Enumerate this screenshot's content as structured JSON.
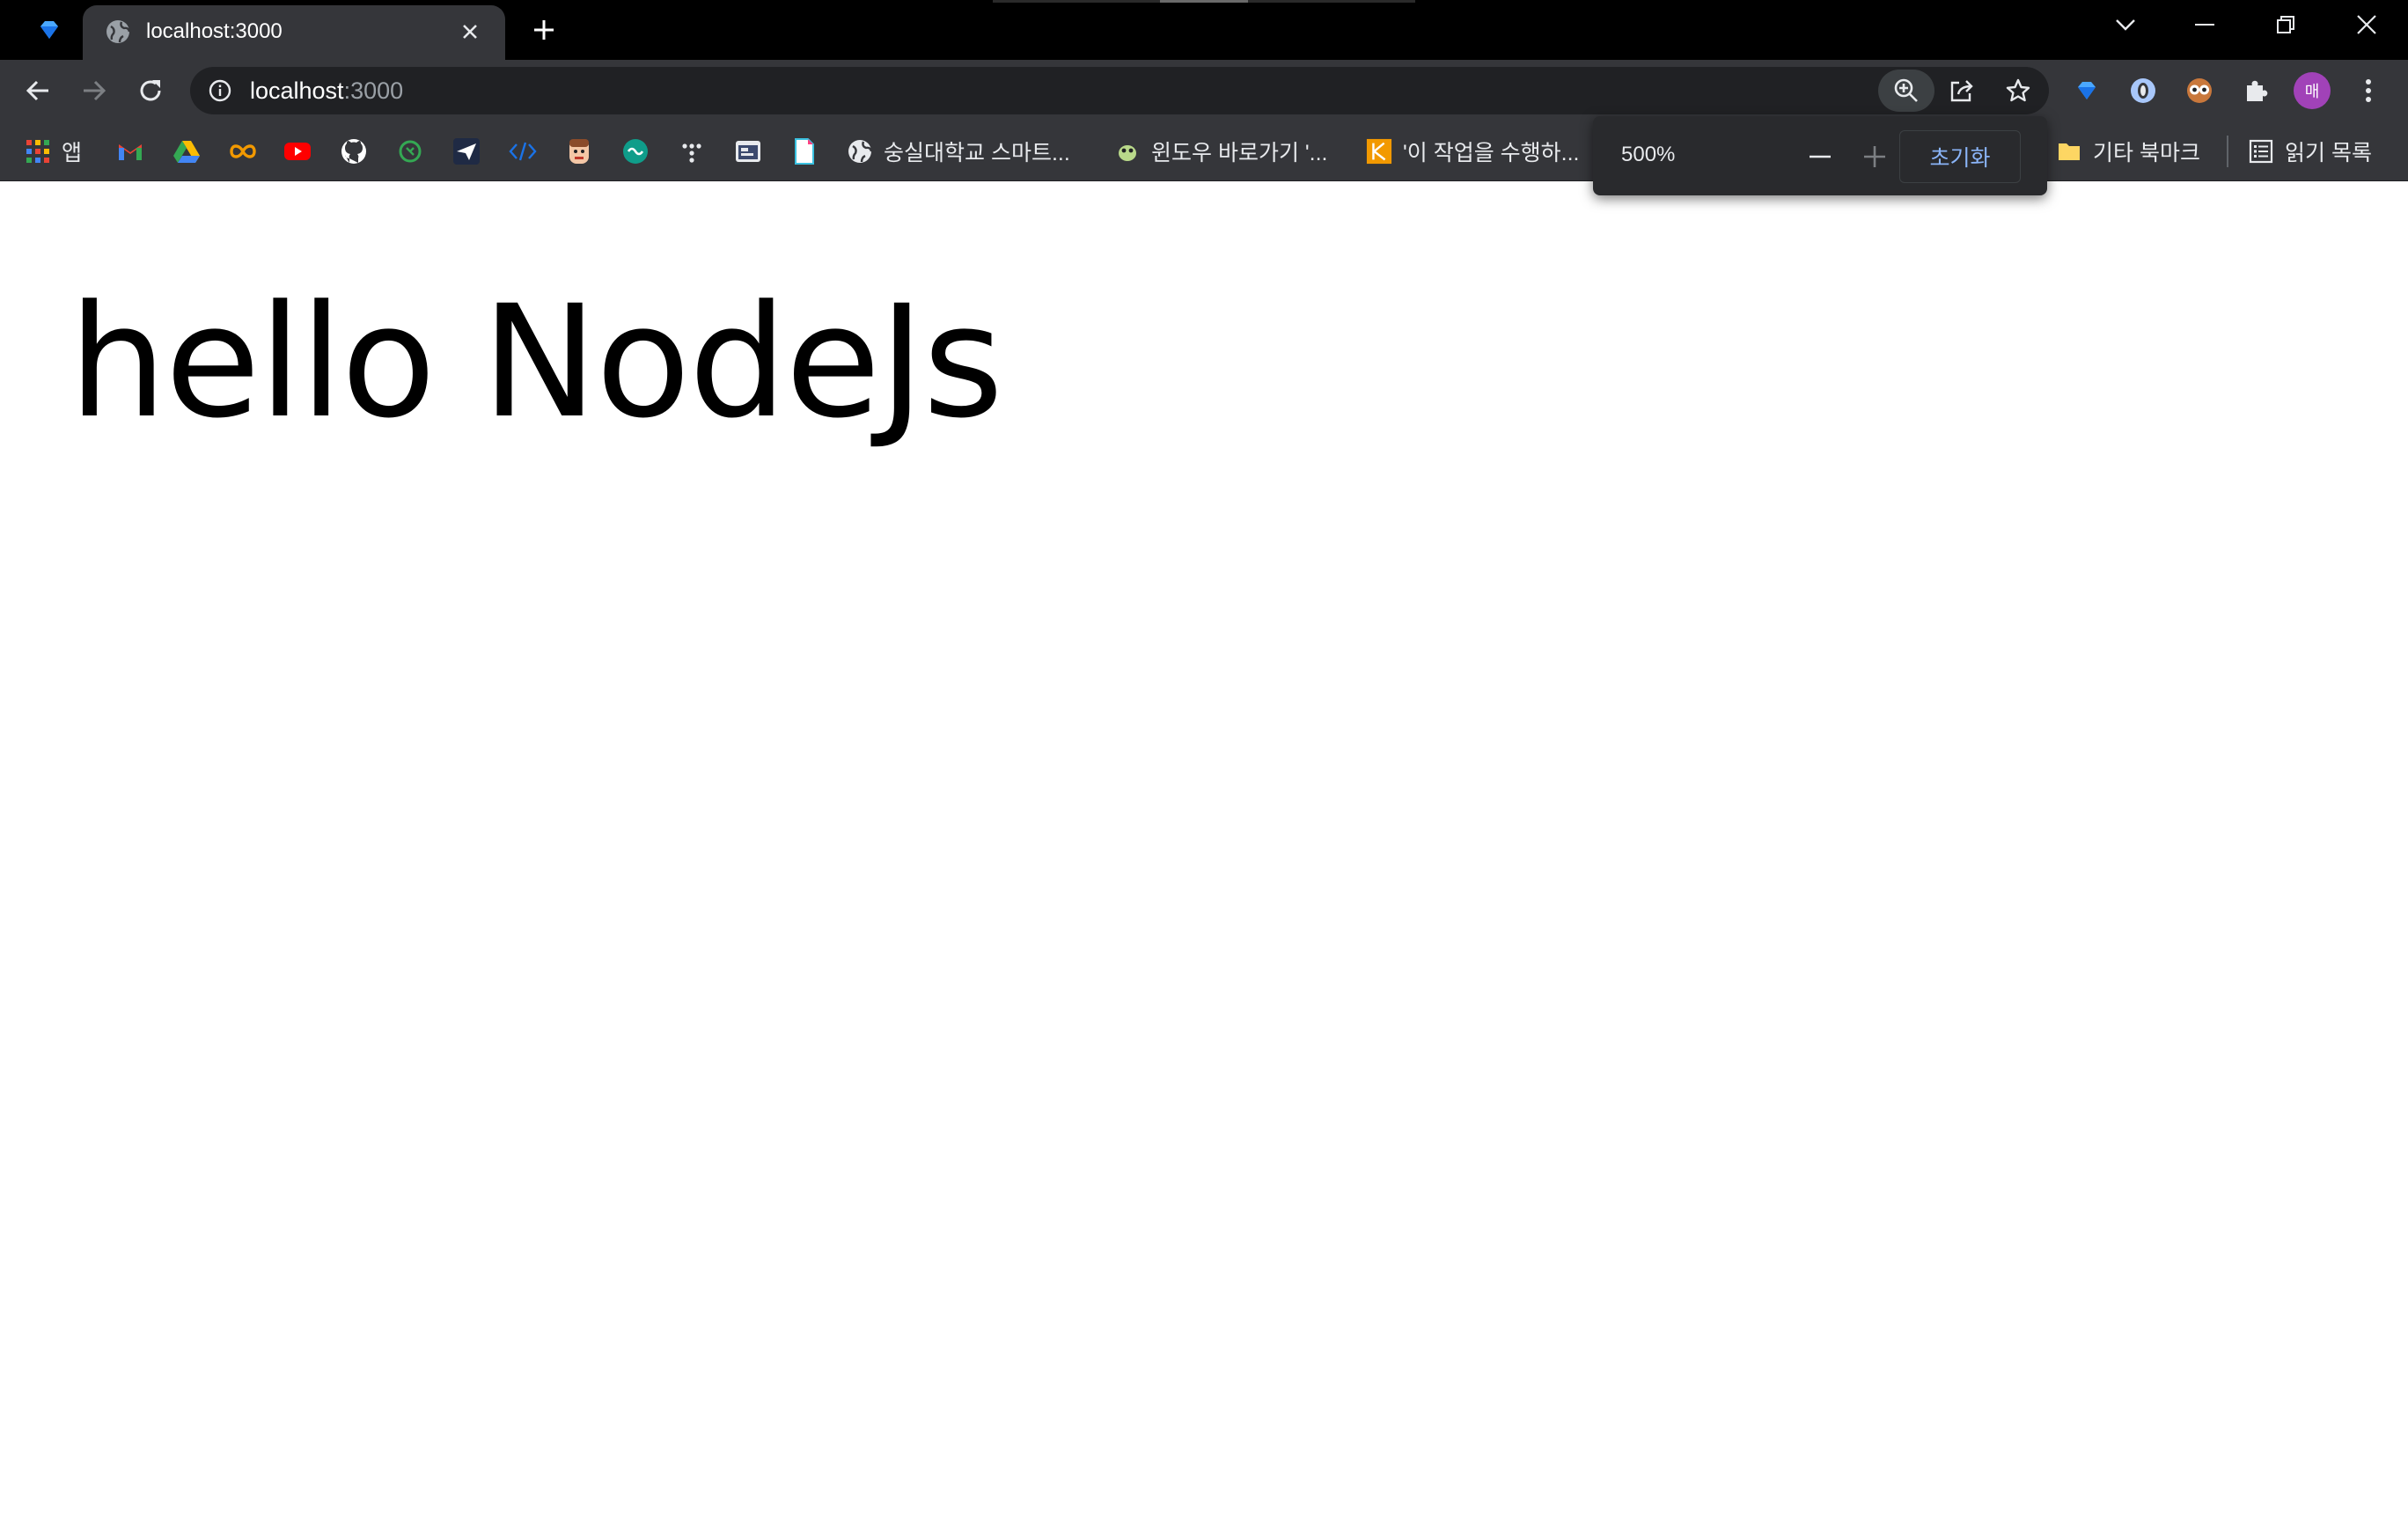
{
  "browser": {
    "tab": {
      "title": "localhost:3000"
    },
    "address_bar": {
      "host": "localhost",
      "port": ":3000"
    },
    "zoom_popup": {
      "level": "500%",
      "reset_label": "초기화"
    },
    "profile": {
      "initial": "매",
      "color": "#a142b8"
    }
  },
  "bookmarks": {
    "apps_label": "앱",
    "items": [
      {
        "label": "숭실대학교 스마트..."
      },
      {
        "label": "윈도우 바로가기 '..."
      },
      {
        "label": "'이 작업을 수행하..."
      }
    ],
    "other_label": "기타 북마크",
    "reading_list_label": "읽기 목록"
  },
  "page": {
    "heading": "hello NodeJs"
  },
  "colors": {
    "tab_strip": "#000000",
    "toolbar": "#35363a",
    "omnibox": "#202124",
    "accent_link": "#8ab4f8"
  }
}
